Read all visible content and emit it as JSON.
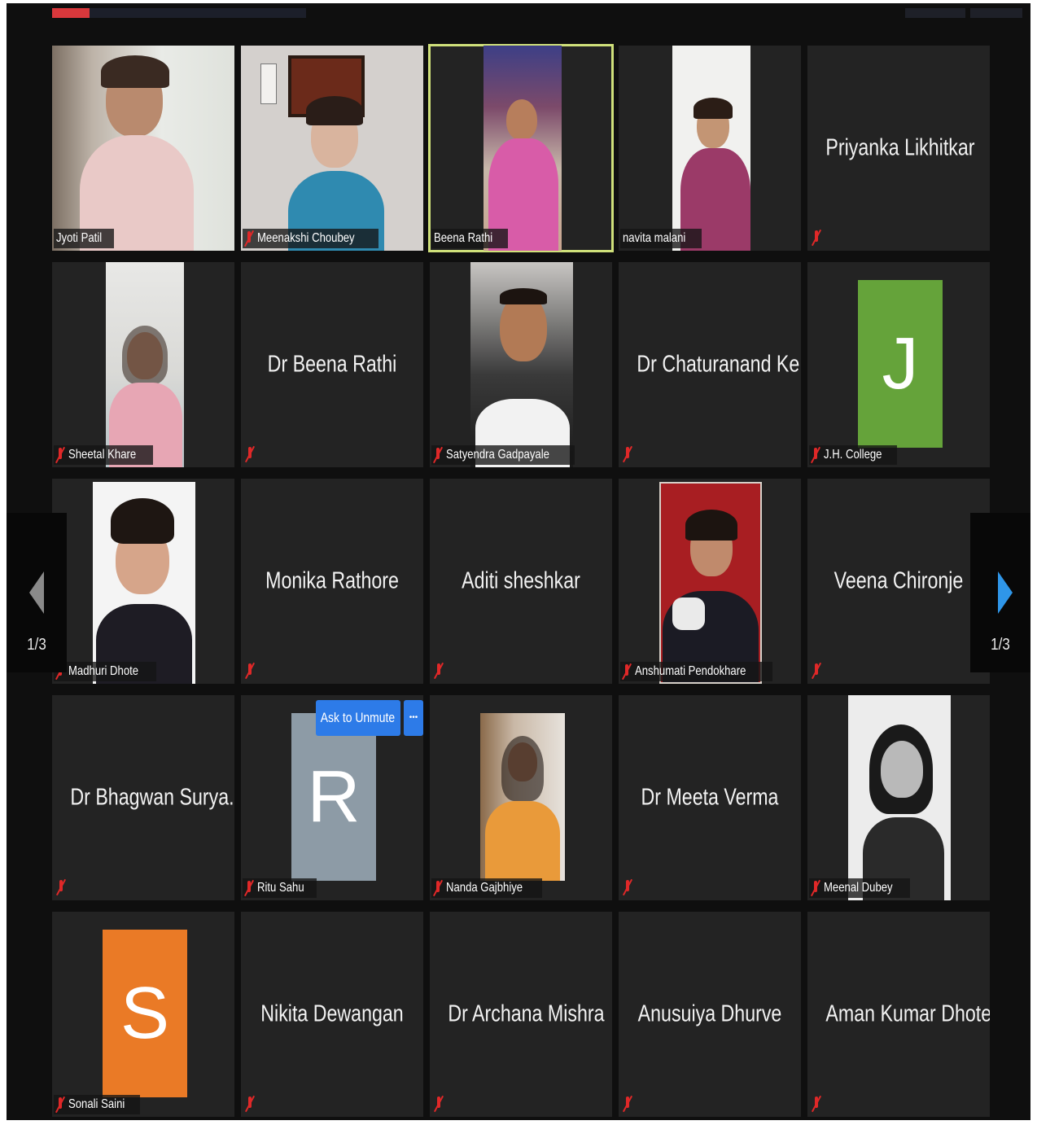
{
  "meeting": {
    "page_indicator": "1/3",
    "ask_to_unmute_label": "Ask to Unmute",
    "more_label": "•••"
  },
  "participants": [
    {
      "name": "Jyoti Patil",
      "type": "video"
    },
    {
      "name": "Meenakshi Choubey",
      "type": "video",
      "muted": true
    },
    {
      "name": "Beena Rathi",
      "type": "video",
      "active_speaker": true
    },
    {
      "name": "navita malani",
      "type": "video"
    },
    {
      "name": "Priyanka Likhitkar",
      "type": "name",
      "muted": true
    },
    {
      "name": "Sheetal Khare",
      "type": "video",
      "muted": true
    },
    {
      "name": "Dr Beena Rathi",
      "type": "name",
      "muted": true
    },
    {
      "name": "Satyendra Gadpayale",
      "type": "video",
      "muted": true
    },
    {
      "name": "Dr Chaturanand Ke...",
      "type": "name",
      "muted": true
    },
    {
      "name": "J.H. College",
      "type": "avatar",
      "initial": "J",
      "color": "#65a33a",
      "muted": true
    },
    {
      "name": "Madhuri Dhote",
      "type": "video",
      "muted": true
    },
    {
      "name": "Monika Rathore",
      "type": "name",
      "muted": true
    },
    {
      "name": "Aditi sheshkar",
      "type": "name",
      "muted": true
    },
    {
      "name": "Anshumati Pendokhare",
      "type": "video",
      "muted": true
    },
    {
      "name": "Veena Chironje",
      "type": "name",
      "muted": true
    },
    {
      "name": "Dr  Bhagwan Surya...",
      "type": "name",
      "muted": true
    },
    {
      "name": "Ritu Sahu",
      "type": "avatar",
      "initial": "R",
      "color": "#8d9ba6",
      "muted": true
    },
    {
      "name": "Nanda Gajbhiye",
      "type": "video",
      "muted": true
    },
    {
      "name": "Dr Meeta Verma",
      "type": "name",
      "muted": true
    },
    {
      "name": "Meenal Dubey",
      "type": "video",
      "muted": true
    },
    {
      "name": "Sonali Saini",
      "type": "avatar",
      "initial": "S",
      "color": "#ea7a26",
      "muted": true
    },
    {
      "name": "Nikita Dewangan",
      "type": "name",
      "muted": true
    },
    {
      "name": "Dr Archana Mishra",
      "type": "name",
      "muted": true
    },
    {
      "name": "Anusuiya Dhurve",
      "type": "name",
      "muted": true
    },
    {
      "name": "Aman Kumar Dhote",
      "type": "name",
      "muted": true
    }
  ]
}
